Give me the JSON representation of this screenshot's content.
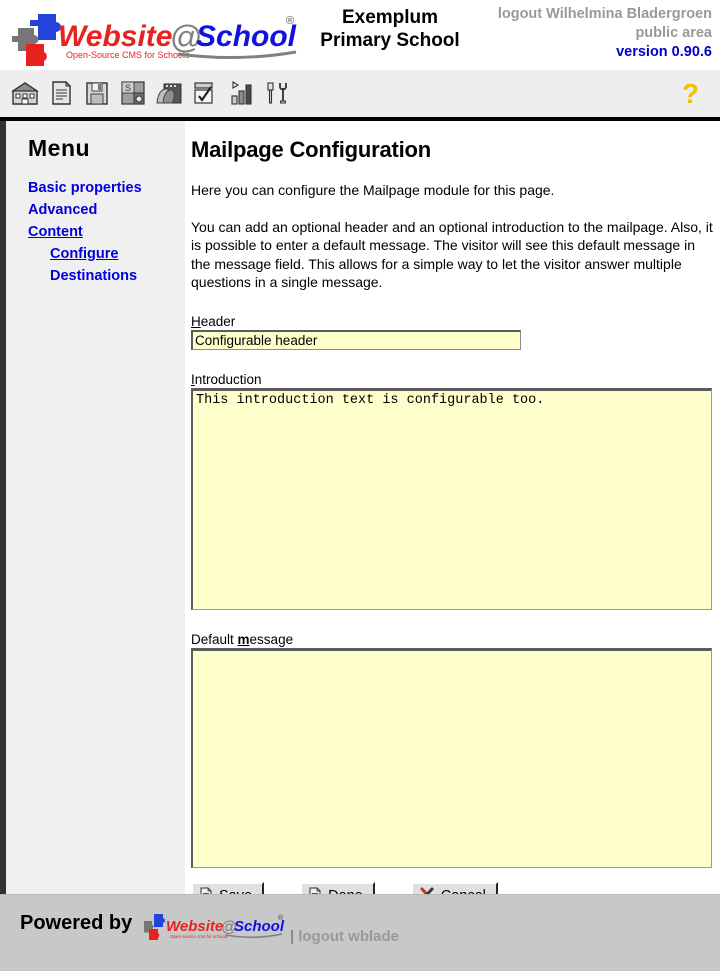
{
  "header": {
    "logo_text": "Website@School",
    "logo_tagline": "Open-Source CMS for Schools",
    "logo_registered": "®",
    "school_line1": "Exemplum",
    "school_line2": "Primary School",
    "logout_user": "logout Wilhelmina Bladergroen",
    "area": "public area",
    "version": "version 0.90.6",
    "colors": {
      "logo_red": "#e8231f",
      "logo_blue": "#0000e0",
      "logo_gray": "#808080",
      "version_blue": "#0000cc",
      "muted_gray": "#999999"
    }
  },
  "toolbar": {
    "icons": [
      {
        "name": "school-icon",
        "title": "School"
      },
      {
        "name": "page-icon",
        "title": "Pages"
      },
      {
        "name": "save-disk-icon",
        "title": "Save"
      },
      {
        "name": "modules-icon",
        "title": "Modules"
      },
      {
        "name": "users-icon",
        "title": "Users"
      },
      {
        "name": "checklist-icon",
        "title": "Tasks"
      },
      {
        "name": "statistics-icon",
        "title": "Statistics"
      },
      {
        "name": "tools-icon",
        "title": "Tools"
      }
    ],
    "help_label": "?"
  },
  "sidebar": {
    "title": "Menu",
    "items": [
      {
        "label": "Basic properties",
        "name": "sidebar-item-basic-properties",
        "underlined": false,
        "sub": false
      },
      {
        "label": "Advanced",
        "name": "sidebar-item-advanced",
        "underlined": false,
        "sub": false
      },
      {
        "label": "Content",
        "name": "sidebar-item-content",
        "underlined": true,
        "sub": false
      },
      {
        "label": "Configure",
        "name": "sidebar-item-configure",
        "underlined": true,
        "sub": true
      },
      {
        "label": "Destinations",
        "name": "sidebar-item-destinations",
        "underlined": false,
        "sub": true
      }
    ]
  },
  "main": {
    "page_title": "Mailpage Configuration",
    "paragraph1": "Here you can configure the Mailpage module for this page.",
    "paragraph2": "You can add an optional header and an optional introduction to the mailpage. Also, it is possible to enter a default message. The visitor will see this default message in the message field. This allows for a simple way to let the visitor answer multiple questions in a single message.",
    "fields": {
      "header": {
        "label_accesskey": "H",
        "label_rest": "eader",
        "value": "Configurable header",
        "placeholder": ""
      },
      "introduction": {
        "label_accesskey": "I",
        "label_rest": "ntroduction",
        "value": "This introduction text is configurable too.",
        "placeholder": ""
      },
      "default_message": {
        "label_prefix": "Default ",
        "label_accesskey": "m",
        "label_rest": "essage",
        "value": "",
        "placeholder": ""
      }
    },
    "buttons": [
      {
        "label": "Save",
        "name": "save-button",
        "icon": "document-icon"
      },
      {
        "label": "Done",
        "name": "done-button",
        "icon": "document-icon"
      },
      {
        "label": "Cancel",
        "name": "cancel-button",
        "icon": "cancel-cross-icon"
      }
    ]
  },
  "footer": {
    "powered_by": "Powered by",
    "logo_text": "Website@School",
    "logo_tagline": "Open source cms for schools",
    "separator": "|",
    "logout": "logout wblade"
  }
}
